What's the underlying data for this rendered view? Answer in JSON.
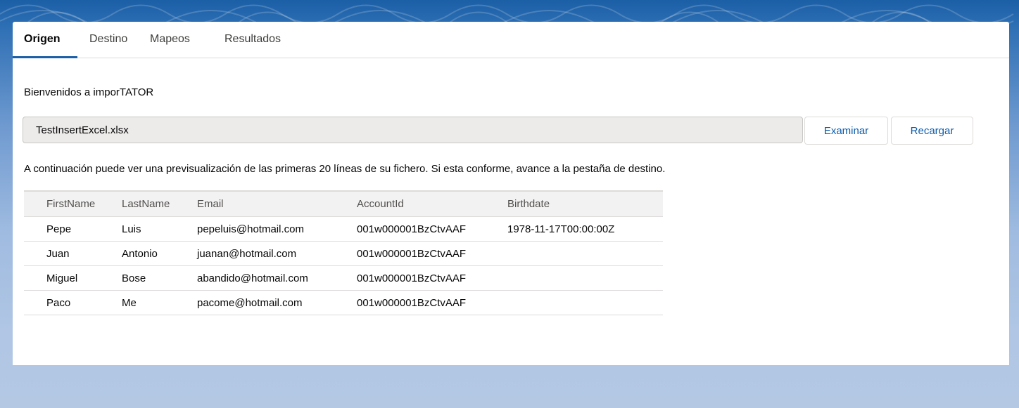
{
  "tabs": [
    {
      "label": "Origen",
      "active": true
    },
    {
      "label": "Destino",
      "active": false
    },
    {
      "label": "Mapeos",
      "active": false
    },
    {
      "label": "Resultados",
      "active": false
    }
  ],
  "welcome_text": "Bienvenidos a imporTATOR",
  "file": {
    "value": "TestInsertExcel.xlsx"
  },
  "buttons": {
    "browse_label": "Examinar",
    "reload_label": "Recargar"
  },
  "info_text": "A continuación puede ver una previsualización de las primeras 20 líneas de su fichero. Si esta conforme, avance a la pestaña de destino.",
  "table": {
    "columns": [
      "FirstName",
      "LastName",
      "Email",
      "AccountId",
      "Birthdate"
    ],
    "rows": [
      [
        "Pepe",
        "Luis",
        "pepeluis@hotmail.com",
        "001w000001BzCtvAAF",
        "1978-11-17T00:00:00Z"
      ],
      [
        "Juan",
        "Antonio",
        "juanan@hotmail.com",
        "001w000001BzCtvAAF",
        ""
      ],
      [
        "Miguel",
        "Bose",
        "abandido@hotmail.com",
        "001w000001BzCtvAAF",
        ""
      ],
      [
        "Paco",
        "Me",
        "pacome@hotmail.com",
        "001w000001BzCtvAAF",
        ""
      ]
    ]
  },
  "colors": {
    "accent": "#1b5fa6",
    "button_text": "#0b5cab",
    "input_bg": "#ecebea",
    "header_bg": "#f3f2f2"
  }
}
